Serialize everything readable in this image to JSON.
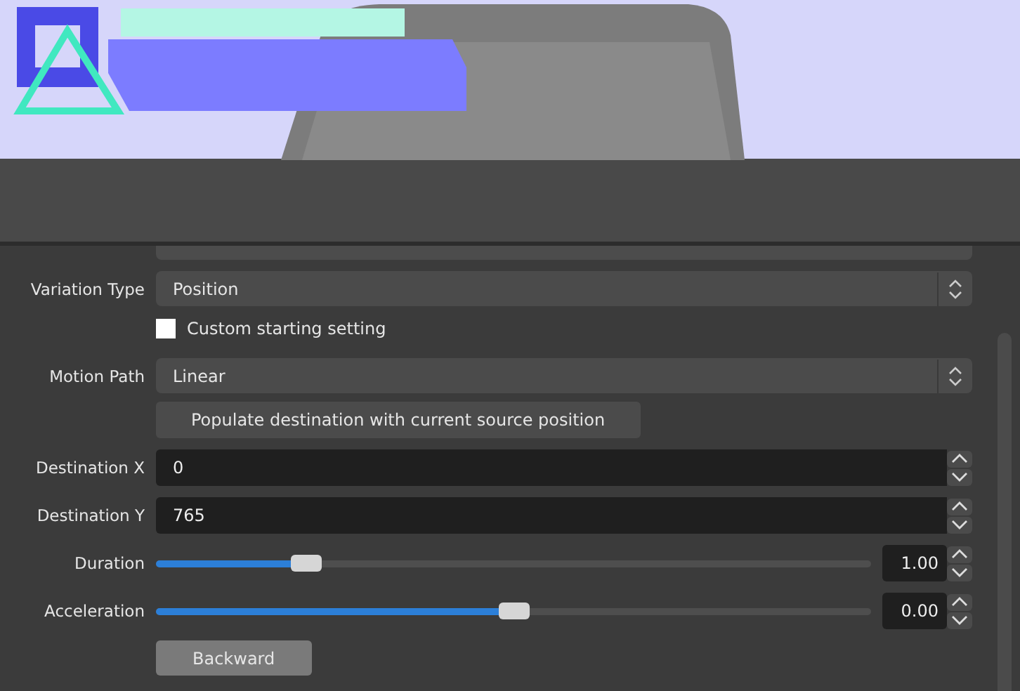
{
  "properties": [
    {
      "kind": "select",
      "label": "Variation Type",
      "value": "Position"
    },
    {
      "kind": "checkbox",
      "label": "Custom starting setting",
      "checked": false
    },
    {
      "kind": "select",
      "label": "Motion Path",
      "value": "Linear"
    },
    {
      "kind": "button",
      "label": "Populate destination with current source position"
    },
    {
      "kind": "spin",
      "label": "Destination X",
      "value": "0"
    },
    {
      "kind": "spin",
      "label": "Destination Y",
      "value": "765"
    },
    {
      "kind": "slider",
      "label": "Duration",
      "level": 0.21,
      "value": "1.00"
    },
    {
      "kind": "slider",
      "label": "Acceleration",
      "level": 0.5,
      "value": "0.00"
    },
    {
      "kind": "button",
      "label": "Backward"
    }
  ]
}
